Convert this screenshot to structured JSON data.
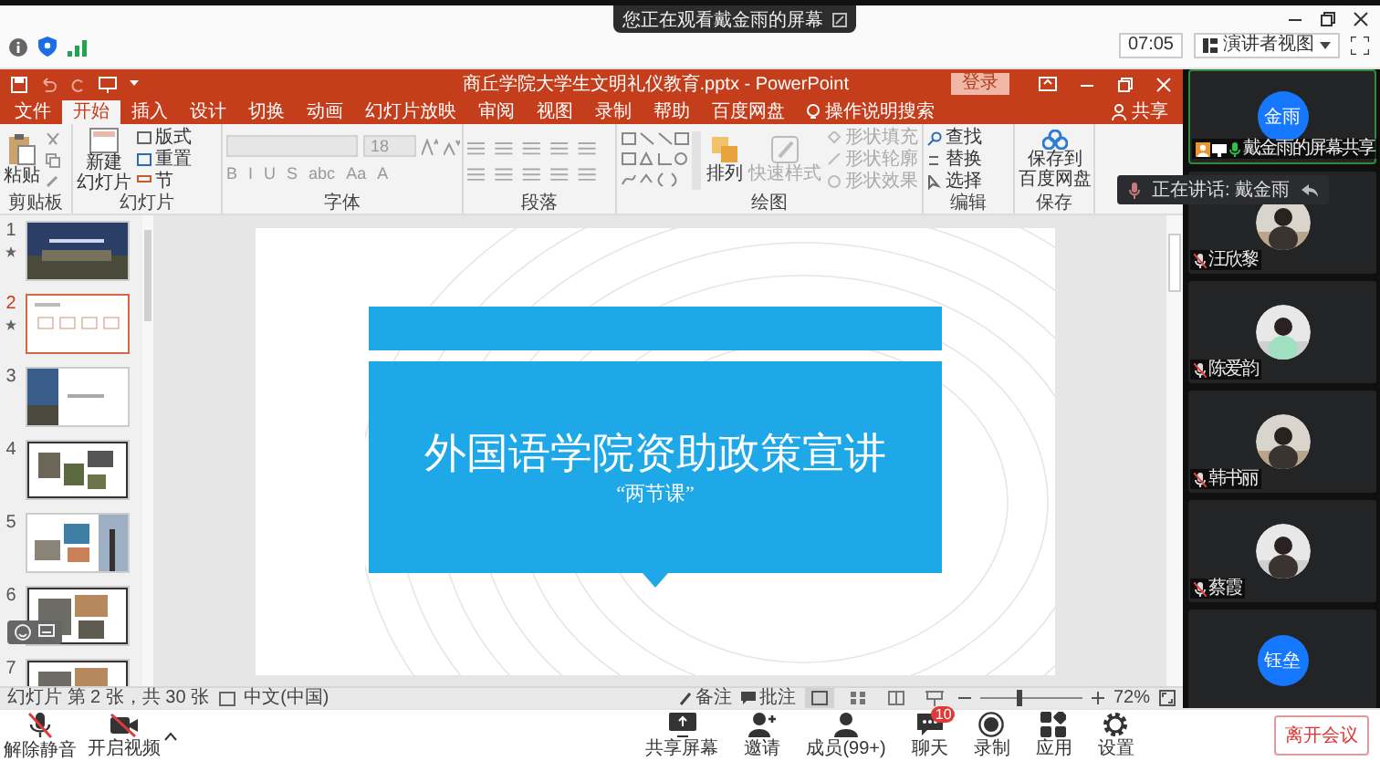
{
  "meeting": {
    "toast": "您正在观看戴金雨的屏幕",
    "time": "07:05",
    "view_button": "演讲者视图"
  },
  "ppt": {
    "title": "商丘学院大学生文明礼仪教育.pptx - PowerPoint",
    "login": "登录",
    "share": "共享",
    "search": "操作说明搜索",
    "tabs": [
      {
        "label": "文件",
        "selected": false
      },
      {
        "label": "开始",
        "selected": true
      },
      {
        "label": "插入",
        "selected": false
      },
      {
        "label": "设计",
        "selected": false
      },
      {
        "label": "切换",
        "selected": false
      },
      {
        "label": "动画",
        "selected": false
      },
      {
        "label": "幻灯片放映",
        "selected": false
      },
      {
        "label": "审阅",
        "selected": false
      },
      {
        "label": "视图",
        "selected": false
      },
      {
        "label": "录制",
        "selected": false
      },
      {
        "label": "帮助",
        "selected": false
      },
      {
        "label": "百度网盘",
        "selected": false
      }
    ],
    "ribbon": {
      "clipboard": {
        "paste": "粘贴",
        "label": "剪贴板"
      },
      "slides": {
        "new_slide": [
          "新建",
          "幻灯片"
        ],
        "layout": "版式",
        "reset": "重置",
        "section": "节",
        "label": "幻灯片"
      },
      "font": {
        "size": "18",
        "buttons": [
          "B",
          "I",
          "U",
          "S",
          "abc",
          "Aa",
          "A"
        ],
        "label": "字体"
      },
      "paragraph": {
        "label": "段落"
      },
      "drawing": {
        "arrange": "排列",
        "quick_styles": "快速样式",
        "fill": "形状填充",
        "outline": "形状轮廓",
        "effects": "形状效果",
        "label": "绘图"
      },
      "editing": {
        "find": "查找",
        "replace": "替换",
        "select": "选择",
        "label": "编辑"
      },
      "save": {
        "button": [
          "保存到",
          "百度网盘"
        ],
        "label": "保存"
      }
    },
    "thumbnails": [
      {
        "number": "1",
        "selected": false,
        "starred": true
      },
      {
        "number": "2",
        "selected": true,
        "starred": true
      },
      {
        "number": "3",
        "selected": false,
        "starred": false
      },
      {
        "number": "4",
        "selected": false,
        "starred": false
      },
      {
        "number": "5",
        "selected": false,
        "starred": false
      },
      {
        "number": "6",
        "selected": false,
        "starred": false
      },
      {
        "number": "7",
        "selected": false,
        "starred": false
      }
    ],
    "slide": {
      "title": "外国语学院资助政策宣讲",
      "subtitle": "“两节课”"
    },
    "status": {
      "slide_info": "幻灯片 第 2 张，共 30 张",
      "language": "中文(中国)",
      "notes": "备注",
      "comments": "批注",
      "zoom": "72%",
      "zoom_slider": {
        "level": 0.37
      }
    }
  },
  "participants": [
    {
      "name": "戴金雨的屏幕共享",
      "kind": "initials",
      "avatar_text": "金雨",
      "speaking": true,
      "mic_on": true
    },
    {
      "name": "汪欣黎",
      "speaking": false,
      "mic_on": false
    },
    {
      "name": "陈爱韵",
      "speaking": false,
      "mic_on": false
    },
    {
      "name": "韩书丽",
      "speaking": false,
      "mic_on": false
    },
    {
      "name": "蔡霞",
      "speaking": false,
      "mic_on": false
    },
    {
      "kind": "initials",
      "avatar_text": "钰垒",
      "speaking": false
    }
  ],
  "speaker_toast": "正在讲话: 戴金雨",
  "toolbar": {
    "left": [
      {
        "label": "解除静音",
        "kind": "mic",
        "off": true
      },
      {
        "label": "开启视频",
        "kind": "video",
        "off": true
      }
    ],
    "center": [
      {
        "label": "共享屏幕",
        "kind": "share"
      },
      {
        "label": "邀请",
        "kind": "invite"
      },
      {
        "label": "成员(99+)",
        "kind": "members"
      },
      {
        "label": "聊天",
        "kind": "chat",
        "badge": "10"
      },
      {
        "label": "录制",
        "kind": "record"
      },
      {
        "label": "应用",
        "kind": "apps"
      },
      {
        "label": "设置",
        "kind": "settings"
      }
    ],
    "leave": "离开会议"
  }
}
